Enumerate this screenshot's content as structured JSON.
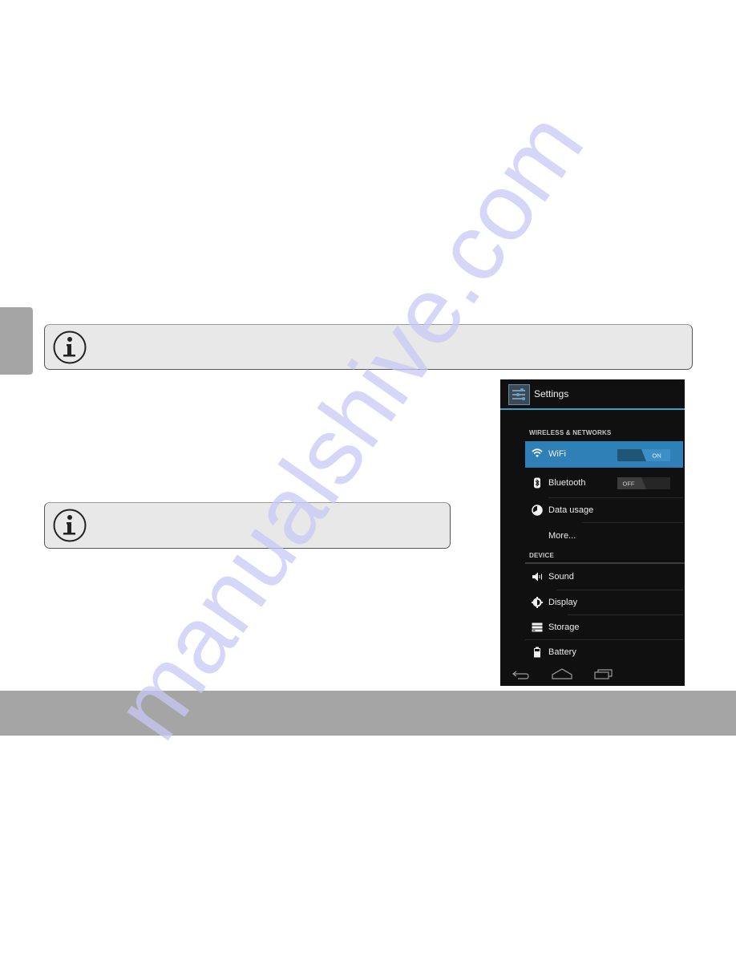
{
  "document": {
    "side_tab_color": "#a6a5a5",
    "footer_color": "#a6a5a5",
    "notes": [
      {
        "icon": "info-icon",
        "text": ""
      },
      {
        "icon": "info-icon",
        "text": ""
      }
    ]
  },
  "settings_screen": {
    "title": "Settings",
    "app_icon": "settings-sliders-icon",
    "accent_color": "#33b5e5",
    "sections": [
      {
        "header": "WIRELESS & NETWORKS",
        "items": [
          {
            "label": "WiFi",
            "icon": "wifi-icon",
            "toggle": "ON",
            "selected": true
          },
          {
            "label": "Bluetooth",
            "icon": "bluetooth-icon",
            "toggle": "OFF",
            "selected": false
          },
          {
            "label": "Data usage",
            "icon": "data-usage-icon"
          },
          {
            "label": "More...",
            "icon": ""
          }
        ]
      },
      {
        "header": "DEVICE",
        "items": [
          {
            "label": "Sound",
            "icon": "sound-icon"
          },
          {
            "label": "Display",
            "icon": "display-icon"
          },
          {
            "label": "Storage",
            "icon": "storage-icon"
          },
          {
            "label": "Battery",
            "icon": "battery-icon"
          }
        ]
      }
    ],
    "nav_buttons": [
      "back-icon",
      "home-icon",
      "recent-apps-icon"
    ]
  },
  "watermark": {
    "text": "manualshive.com",
    "color": "#c8c8f5"
  }
}
